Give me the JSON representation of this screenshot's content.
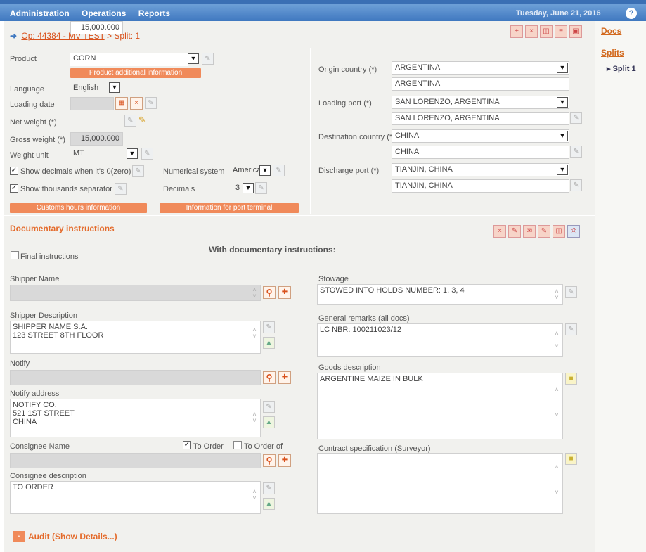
{
  "topbar": {
    "nav": [
      "Administration",
      "Operations",
      "Reports"
    ],
    "date": "Tuesday, June 21, 2016",
    "help_icon": "help-icon"
  },
  "breadcrumb": {
    "op_link": "Op: 44384 - MV TEST",
    "separator": ">",
    "current": "Split: 1"
  },
  "sidebar": {
    "docs": "Docs",
    "splits": "Splits",
    "split_item": "Split 1"
  },
  "product": {
    "label": "Product",
    "value": "CORN",
    "additional_info_button": "Product additional information"
  },
  "language": {
    "label": "Language",
    "value": "English"
  },
  "loading_date": {
    "label": "Loading date",
    "value": ""
  },
  "net_weight": {
    "label": "Net weight (*)",
    "value": "15,000.000"
  },
  "gross_weight": {
    "label": "Gross weight (*)",
    "value": "15,000.000"
  },
  "weight_unit": {
    "label": "Weight unit",
    "value": "MT"
  },
  "show_decimals": {
    "label": "Show decimals when it's 0(zero)",
    "checked": true
  },
  "show_thousands": {
    "label": "Show thousands separator",
    "checked": true
  },
  "numerical_system": {
    "label": "Numerical system",
    "value": "American"
  },
  "decimals": {
    "label": "Decimals",
    "value": "3"
  },
  "buttons": {
    "customs_hours": "Customs hours information",
    "port_terminal": "Information for port terminal"
  },
  "origin_country": {
    "label": "Origin country (*)",
    "value": "ARGENTINA",
    "sub": "ARGENTINA"
  },
  "loading_port": {
    "label": "Loading port (*)",
    "value": "SAN LORENZO, ARGENTINA",
    "sub": "SAN LORENZO, ARGENTINA"
  },
  "destination_country": {
    "label": "Destination country (*)",
    "value": "CHINA",
    "sub": "CHINA"
  },
  "discharge_port": {
    "label": "Discharge port (*)",
    "value": "TIANJIN, CHINA",
    "sub": "TIANJIN, CHINA"
  },
  "documentary": {
    "title": "Documentary instructions",
    "final_instructions": "Final instructions",
    "with_instructions": "With documentary instructions:"
  },
  "shipper_name": {
    "label": "Shipper Name",
    "value": ""
  },
  "shipper_description": {
    "label": "Shipper Description",
    "value": "SHIPPER NAME S.A.\n123 STREET 8TH FLOOR"
  },
  "notify": {
    "label": "Notify",
    "value": ""
  },
  "notify_address": {
    "label": "Notify address",
    "value": "NOTIFY CO.\n521 1ST STREET\nCHINA"
  },
  "consignee_name": {
    "label": "Consignee Name",
    "value": "",
    "to_order": "To Order",
    "to_order_checked": true,
    "to_order_of": "To Order of",
    "to_order_of_checked": false
  },
  "consignee_description": {
    "label": "Consignee description",
    "value": "TO ORDER"
  },
  "stowage": {
    "label": "Stowage",
    "value": "STOWED INTO HOLDS NUMBER: 1, 3, 4"
  },
  "general_remarks": {
    "label": "General remarks (all docs)",
    "value": "LC NBR: 100211023/12"
  },
  "goods_description": {
    "label": "Goods description",
    "value": "ARGENTINE MAIZE IN BULK"
  },
  "contract_specification": {
    "label": "Contract specification (Surveyor)",
    "value": ""
  },
  "audit": {
    "label": "Audit (Show Details...)"
  }
}
